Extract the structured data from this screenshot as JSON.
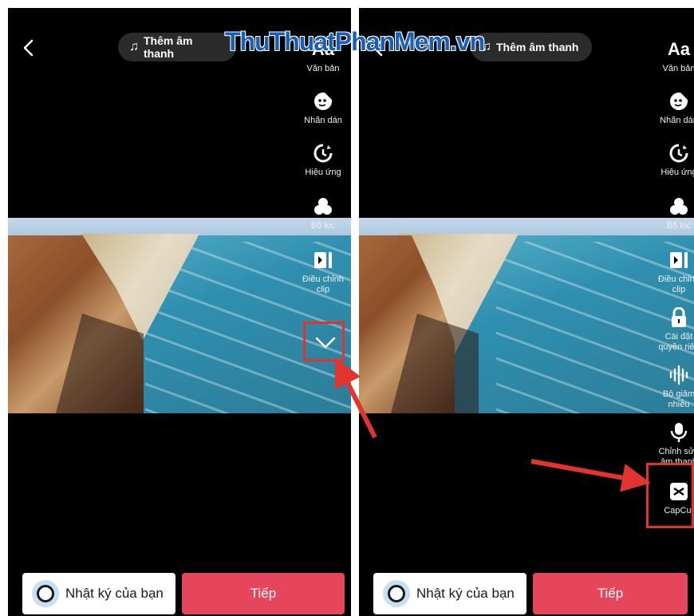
{
  "watermark": "ThuThuatPhanMem.vn",
  "accent_color": "#e5465b",
  "highlight_color": "#e2342f",
  "left_panel": {
    "back_icon": "chevron-left-icon",
    "sound_button": "Thêm âm thanh",
    "tools": [
      {
        "icon": "Aa",
        "label": "Văn bản"
      },
      {
        "icon": "sticker-icon",
        "label": "Nhãn dán"
      },
      {
        "icon": "effects-timer-icon",
        "label": "Hiệu ứng"
      },
      {
        "icon": "filter-circles-icon",
        "label": "Bộ lọc"
      },
      {
        "icon": "clip-adjust-icon",
        "label": "Điều chỉnh\nclip"
      }
    ],
    "expand_icon": "chevron-down-icon",
    "diary_button": "Nhật ký của bạn",
    "next_button": "Tiếp"
  },
  "right_panel": {
    "sound_button": "Thêm âm thanh",
    "tools": [
      {
        "icon": "Aa",
        "label": "Văn bản"
      },
      {
        "icon": "sticker-icon",
        "label": "Nhãn dán"
      },
      {
        "icon": "effects-timer-icon",
        "label": "Hiệu ứng"
      },
      {
        "icon": "filter-circles-icon",
        "label": "Bộ lọc"
      },
      {
        "icon": "clip-adjust-icon",
        "label": "Điều chỉnh\nclip"
      },
      {
        "icon": "lock-icon",
        "label": "Cài đặt\nquyền riên"
      },
      {
        "icon": "noise-reduce-icon",
        "label": "Bộ giảm\nnhiễu"
      },
      {
        "icon": "microphone-icon",
        "label": "Chỉnh sửa\nâm thanh"
      },
      {
        "icon": "capcut-icon",
        "label": "CapCut"
      }
    ],
    "diary_button": "Nhật ký của bạn",
    "next_button": "Tiếp"
  }
}
